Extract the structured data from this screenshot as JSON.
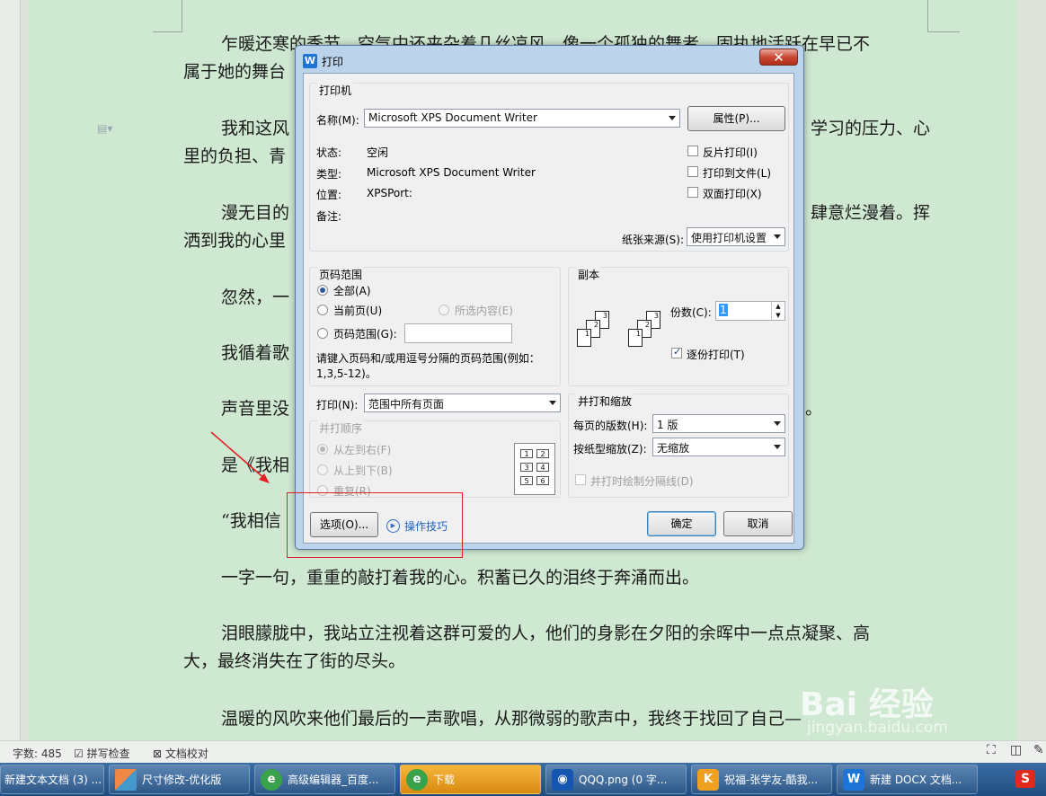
{
  "document": {
    "paragraphs": [
      {
        "lines": [
          "乍暖还寒的季节，空气中还夹杂着几丝凉风，像一个孤独的舞者，固执地活跃在早已不",
          "属于她的舞台"
        ]
      },
      {
        "lines": [
          "我和这风",
          "学习的压力、心",
          "里的负担、青"
        ]
      },
      {
        "lines": [
          "漫无目的",
          "肆意烂漫着。挥",
          "洒到我的心里"
        ]
      },
      {
        "lines": [
          "忽然，一"
        ]
      },
      {
        "lines": [
          "我循着歌"
        ]
      },
      {
        "lines": [
          "声音里没",
          "。"
        ]
      },
      {
        "lines": [
          "是《我相"
        ]
      },
      {
        "lines": [
          "“我相信"
        ]
      },
      {
        "lines": [
          "一字一句，重重的敲打着我的心。积蓄已久的泪终于奔涌而出。"
        ]
      },
      {
        "lines": [
          "泪眼朦胧中，我站立注视着这群可爱的人，他们的身影在夕阳的余晖中一点点凝聚、高",
          "大，最终消失在了街的尽头。"
        ]
      },
      {
        "lines": [
          "温暖的风吹来他们最后的一声歌唱，从那微弱的歌声中，我终于找回了自己—"
        ]
      }
    ]
  },
  "dialog": {
    "title": "打印",
    "close": "✕",
    "printer": {
      "group_title": "打印机",
      "name_label": "名称(M):",
      "name_value": "Microsoft XPS Document Writer",
      "properties_button": "属性(P)...",
      "status_label": "状态:",
      "status_value": "空闲",
      "type_label": "类型:",
      "type_value": "Microsoft XPS Document Writer",
      "location_label": "位置:",
      "location_value": "XPSPort:",
      "comment_label": "备注:",
      "reverse_print": "反片打印(I)",
      "print_to_file": "打印到文件(L)",
      "duplex": "双面打印(X)",
      "paper_source_label": "纸张来源(S):",
      "paper_source_value": "使用打印机设置"
    },
    "page_range": {
      "group_title": "页码范围",
      "all": "全部(A)",
      "current": "当前页(U)",
      "selection": "所选内容(E)",
      "range": "页码范围(G):",
      "hint_line1": "请键入页码和/或用逗号分隔的页码范围(例如：",
      "hint_line2": "1,3,5-12)。"
    },
    "copies": {
      "group_title": "副本",
      "count_label": "份数(C):",
      "count_value": "1",
      "collate": "逐份打印(T)"
    },
    "print_what": {
      "label": "打印(N):",
      "value": "范围中所有页面"
    },
    "order": {
      "group_title": "并打顺序",
      "ltr": "从左到右(F)",
      "ttb": "从上到下(B)",
      "repeat": "重复(R)",
      "grid": [
        "1",
        "2",
        "3",
        "4",
        "5",
        "6"
      ]
    },
    "zoom": {
      "group_title": "并打和缩放",
      "pages_per_sheet_label": "每页的版数(H):",
      "pages_per_sheet_value": "1 版",
      "scale_label": "按纸型缩放(Z):",
      "scale_value": "无缩放",
      "draw_borders": "并打时绘制分隔线(D)"
    },
    "options_button": "选项(O)...",
    "tips_link": "操作技巧",
    "ok_button": "确定",
    "cancel_button": "取消"
  },
  "statusbar": {
    "word_count": "字数: 485",
    "spell_check": "拼写检查",
    "doc_check": "文档校对"
  },
  "taskbar": {
    "items": [
      "新建文本文档 (3) ...",
      "尺寸修改-优化版",
      "高级编辑器_百度...",
      "下载",
      "QQQ.png (0 字...",
      "祝福-张学友-酷我...",
      "新建 DOCX 文档..."
    ],
    "tray": "S"
  },
  "watermark": {
    "main": "Bai 经验",
    "sub": "jingyan.baidu.com"
  }
}
